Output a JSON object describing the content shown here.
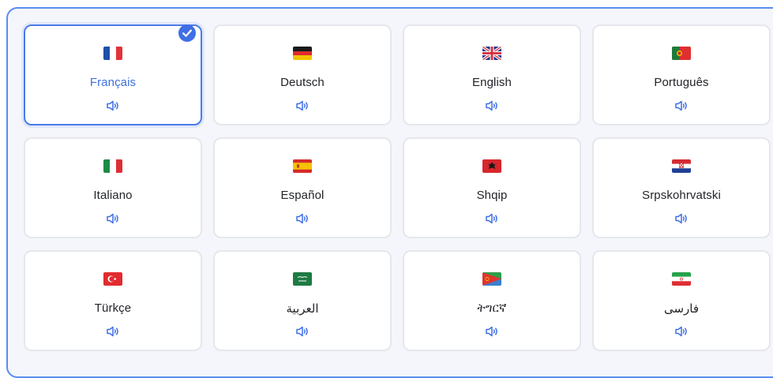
{
  "languages": [
    {
      "name": "Français",
      "flag": "flag-france",
      "selected": true
    },
    {
      "name": "Deutsch",
      "flag": "flag-germany",
      "selected": false
    },
    {
      "name": "English",
      "flag": "flag-uk",
      "selected": false
    },
    {
      "name": "Português",
      "flag": "flag-portugal",
      "selected": false
    },
    {
      "name": "Italiano",
      "flag": "flag-italy",
      "selected": false
    },
    {
      "name": "Español",
      "flag": "flag-spain",
      "selected": false
    },
    {
      "name": "Shqip",
      "flag": "flag-albania",
      "selected": false
    },
    {
      "name": "Srpskohrvatski",
      "flag": "flag-croatia",
      "selected": false
    },
    {
      "name": "Türkçe",
      "flag": "flag-turkey",
      "selected": false
    },
    {
      "name": "العربية",
      "flag": "flag-saudi-arabia",
      "selected": false
    },
    {
      "name": "ትግርኛ",
      "flag": "flag-eritrea",
      "selected": false
    },
    {
      "name": "فارسی",
      "flag": "flag-iran",
      "selected": false
    }
  ],
  "colors": {
    "accent": "#3f6fe5",
    "panel_border": "#5b8def",
    "card_border": "#e5e7ec"
  },
  "icons": {
    "speaker": "speaker-icon",
    "check": "checkmark-icon"
  }
}
